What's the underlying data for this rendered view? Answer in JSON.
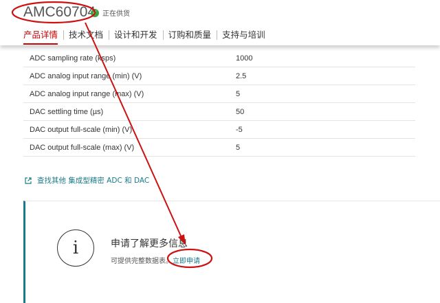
{
  "header": {
    "title": "AMC60704",
    "status": "正在供货",
    "tabs": [
      {
        "label": "产品详情",
        "active": true
      },
      {
        "label": "技术文档",
        "active": false
      },
      {
        "label": "设计和开发",
        "active": false
      },
      {
        "label": "订购和质量",
        "active": false
      },
      {
        "label": "支持与培训",
        "active": false
      }
    ]
  },
  "params": [
    {
      "name": "ADC sampling rate (ksps)",
      "value": "1000"
    },
    {
      "name": "ADC analog input range (min) (V)",
      "value": "2.5"
    },
    {
      "name": "ADC analog input range (max) (V)",
      "value": "5"
    },
    {
      "name": "DAC settling time (µs)",
      "value": "50"
    },
    {
      "name": "DAC output full-scale (min) (V)",
      "value": "-5"
    },
    {
      "name": "DAC output full-scale (max) (V)",
      "value": "5"
    }
  ],
  "find_link": "查找其他 集成型精密 ADC 和 DAC",
  "info": {
    "icon_text": "i",
    "heading": "申请了解更多信息",
    "desc": "可提供完整数据表。",
    "link": "立即申请"
  },
  "colors": {
    "accent": "#cc0000",
    "teal": "#1a7a8a",
    "status_green": "#3ca142",
    "annotation": "#cc1111"
  },
  "icons": [
    "check-circle-icon",
    "external-link-icon",
    "info-icon"
  ]
}
